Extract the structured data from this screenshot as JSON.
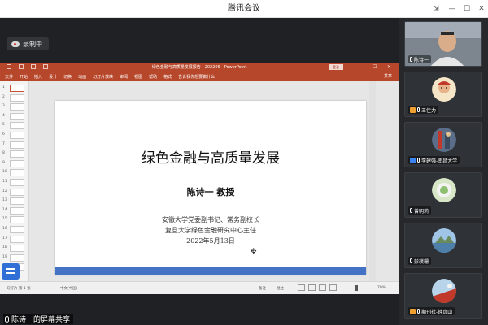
{
  "window": {
    "title": "腾讯会议"
  },
  "recording": {
    "label": "录制中"
  },
  "powerpoint": {
    "title": "绿色金融与高质量发展报告—202205 - PowerPoint",
    "login_label": "登录",
    "ribbon_tabs": [
      "文件",
      "开始",
      "插入",
      "设计",
      "切换",
      "动画",
      "幻灯片放映",
      "审阅",
      "视图",
      "帮助",
      "格式"
    ],
    "tell_me": "告诉我你想要做什么",
    "share": "共享",
    "status": {
      "slide_info": "幻灯片 第 1 张",
      "lang": "中文(中国)",
      "notes": "备注",
      "comments": "批注",
      "zoom": "79%"
    },
    "thumb_numbers": [
      "1",
      "2",
      "3",
      "4",
      "5",
      "6",
      "7",
      "8",
      "9",
      "10",
      "11",
      "12",
      "13",
      "14",
      "15",
      "16",
      "17",
      "18",
      "19",
      "20"
    ]
  },
  "slide": {
    "title": "绿色金融与高质量发展",
    "presenter": "陈诗一 教授",
    "line1": "安徽大学党委副书记、常务副校长",
    "line2": "复旦大学绿色金融研究中心主任",
    "date": "2022年5月13日"
  },
  "share_label": "陈诗一的屏幕共享",
  "participants": [
    {
      "name": "陈诗一",
      "badge": "mic"
    },
    {
      "name": "王佳力",
      "badge": "host"
    },
    {
      "name": "李建强-南昌大学",
      "badge": "cohost"
    },
    {
      "name": "曾明莉",
      "badge": "mic"
    },
    {
      "name": "彭璞珊",
      "badge": "mic"
    },
    {
      "name": "期刊社-钟贞山",
      "badge": "host"
    }
  ],
  "colors": {
    "ppt_accent": "#b7472a",
    "slide_bar": "#4472c4",
    "meeting_bg": "#1f2124"
  }
}
